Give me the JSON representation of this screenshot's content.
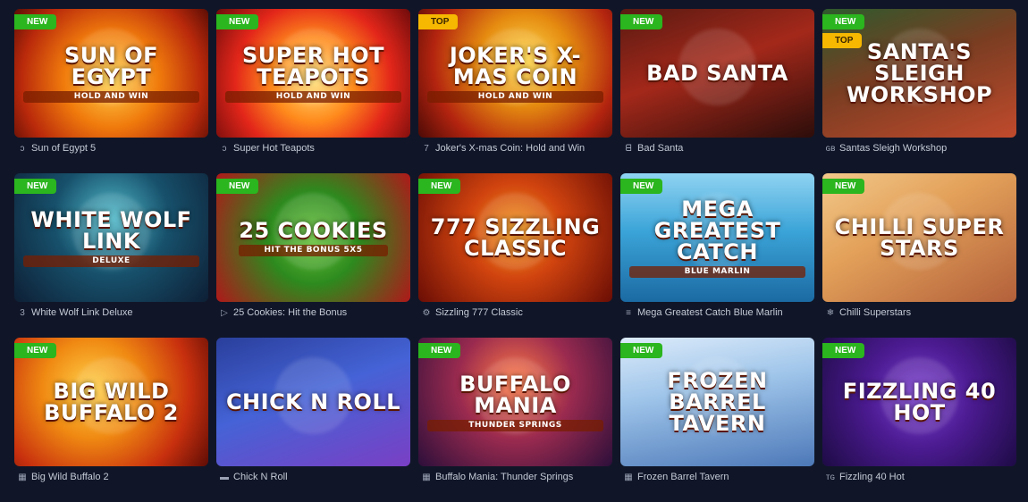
{
  "games": [
    {
      "title": "Sun of Egypt 5",
      "art": "Sun of Egypt",
      "sub": "Hold and Win",
      "badges": [
        "NEW"
      ],
      "provider_icon": "swirl-icon",
      "glyph": "ↄ",
      "bg": "radial-gradient(circle at 50% 55%, #ffd34d 0%, #f07a0c 40%, #b9290b 75%, #5b0d05 100%)"
    },
    {
      "title": "Super Hot Teapots",
      "art": "Super Hot Teapots",
      "sub": "Hold and Win",
      "badges": [
        "NEW"
      ],
      "provider_icon": "swirl-icon",
      "glyph": "ↄ",
      "bg": "radial-gradient(circle at 50% 55%, #ffe27a 0%, #ff8a1c 35%, #e3261a 65%, #6e0b0b 100%)"
    },
    {
      "title": "Joker's X-mas Coin: Hold and Win",
      "art": "Joker's X-mas Coin",
      "sub": "Hold and Win",
      "badges": [
        "TOP"
      ],
      "provider_icon": "seven-icon",
      "glyph": "7",
      "bg": "radial-gradient(circle at 55% 40%, #ffd84a 0%, #e58b10 35%, #b3240f 70%, #4c0a06 100%)"
    },
    {
      "title": "Bad Santa",
      "art": "Bad Santa",
      "sub": "",
      "badges": [
        "NEW"
      ],
      "provider_icon": "b-icon",
      "glyph": "ᗺ",
      "bg": "linear-gradient(160deg, #5a1a12 0%, #a3281a 45%, #2c0d0a 100%)"
    },
    {
      "title": "Santas Sleigh Workshop",
      "art": "Santa's Sleigh Workshop",
      "sub": "",
      "badges": [
        "NEW",
        "TOP"
      ],
      "provider_icon": "gb-icon",
      "glyph": "ɢʙ",
      "bg": "linear-gradient(160deg, #2d5a2d 0%, #7a3d22 45%, #c14a2c 100%)"
    },
    {
      "title": "White Wolf Link Deluxe",
      "art": "White Wolf Link",
      "sub": "Deluxe",
      "badges": [
        "NEW"
      ],
      "provider_icon": "three-icon",
      "glyph": "3",
      "bg": "radial-gradient(circle at 50% 35%, #4fb9c9 0%, #17506b 45%, #0d1f35 100%)"
    },
    {
      "title": "25 Cookies: Hit the Bonus",
      "art": "25 Cookies",
      "sub": "Hit the Bonus 5x5",
      "badges": [
        "NEW"
      ],
      "provider_icon": "play-icon",
      "glyph": "▷",
      "bg": "radial-gradient(circle at 50% 50%, #67c23a 0%, #2d8a1e 40%, #b0171a 100%)"
    },
    {
      "title": "Sizzling 777 Classic",
      "art": "777 Sizzling Classic",
      "sub": "",
      "badges": [
        "NEW"
      ],
      "provider_icon": "gear-icon",
      "glyph": "⚙",
      "bg": "radial-gradient(circle at 50% 45%, #f29a1b 0%, #d1440f 40%, #6a0d05 100%)"
    },
    {
      "title": "Mega Greatest Catch Blue Marlin",
      "art": "Mega Greatest Catch",
      "sub": "Blue Marlin",
      "badges": [
        "NEW"
      ],
      "provider_icon": "bars-icon",
      "glyph": "≡",
      "bg": "linear-gradient(180deg, #8fd3f2 0%, #3ba4d8 45%, #1b6aa3 100%)"
    },
    {
      "title": "Chilli Superstars",
      "art": "Chilli Super Stars",
      "sub": "",
      "badges": [
        "NEW"
      ],
      "provider_icon": "snowflake-icon",
      "glyph": "❄",
      "bg": "linear-gradient(150deg, #f2c88a 0%, #e3a15a 40%, #b3603a 100%)"
    },
    {
      "title": "Big Wild Buffalo 2",
      "art": "Big Wild Buffalo 2",
      "sub": "",
      "badges": [
        "NEW"
      ],
      "provider_icon": "grid-icon",
      "glyph": "▦",
      "bg": "radial-gradient(circle at 40% 40%, #ffd14a 0%, #f08a12 35%, #c8300e 70%, #5e0c05 100%)"
    },
    {
      "title": "Chick N Roll",
      "art": "Chick N Roll",
      "sub": "",
      "badges": [],
      "provider_icon": "dash-icon",
      "glyph": "▬",
      "bg": "linear-gradient(160deg, #2a3f9c 0%, #4563d6 45%, #7a3fc4 100%)"
    },
    {
      "title": "Buffalo Mania: Thunder Springs",
      "art": "Buffalo Mania",
      "sub": "Thunder Springs",
      "badges": [
        "NEW"
      ],
      "provider_icon": "grid-icon",
      "glyph": "▦",
      "bg": "radial-gradient(circle at 50% 35%, #ff7a45 0%, #9a2a4f 45%, #2c0f3a 100%)"
    },
    {
      "title": "Frozen Barrel Tavern",
      "art": "Frozen Barrel Tavern",
      "sub": "",
      "badges": [
        "NEW"
      ],
      "provider_icon": "grid-icon",
      "glyph": "▦",
      "bg": "linear-gradient(170deg, #dcebfa 0%, #9fc5ea 40%, #4c78b8 100%)"
    },
    {
      "title": "Fizzling 40 Hot",
      "art": "Fizzling 40 Hot",
      "sub": "",
      "badges": [
        "NEW"
      ],
      "provider_icon": "tg-icon",
      "glyph": "ᴛɢ",
      "bg": "radial-gradient(circle at 50% 45%, #7b3fd1 0%, #4a1a8f 45%, #1e0b45 100%)"
    }
  ]
}
